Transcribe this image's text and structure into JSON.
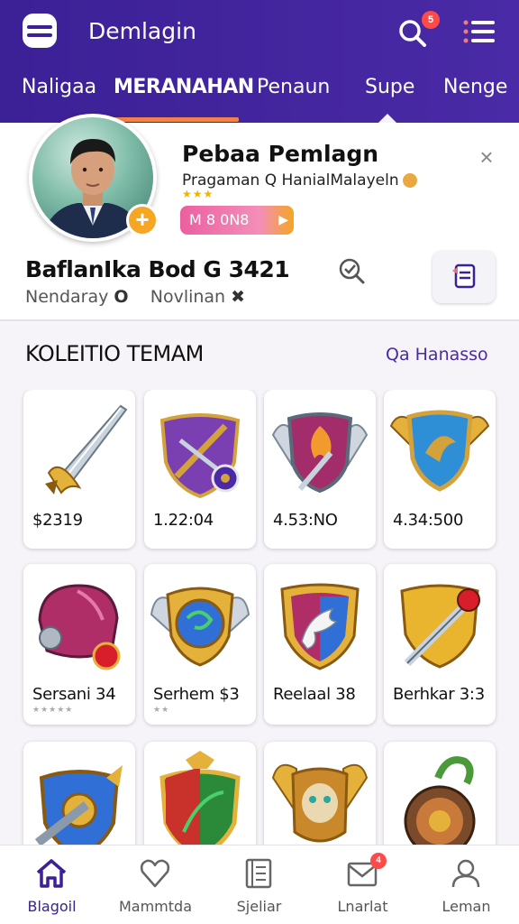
{
  "header": {
    "title": "Demlagin",
    "notification_count": "5",
    "colors": {
      "background": "#3b2096",
      "accent": "#f2824a"
    }
  },
  "tabs": [
    {
      "label": "Naligaa",
      "active": false
    },
    {
      "label": "MERANAHAN",
      "active": true
    },
    {
      "label": "Penaun",
      "active": false
    },
    {
      "label": "Supe",
      "active": false
    },
    {
      "label": "Nenge",
      "active": false
    }
  ],
  "profile": {
    "name": "Pebaa Pemlagn",
    "subtitle": "Pragaman  Q  HanialMalayeln",
    "stars": "★★★",
    "pill_label": "M 8 0N8",
    "main_title": "BaflanIka Bod G 3421",
    "meta_left": "Nendaray",
    "meta_left_icon": "O",
    "meta_right": "Novlinan",
    "meta_right_icon": "✖"
  },
  "section": {
    "title": "KOLEITIO TEMAM",
    "link": "Qa Hanasso"
  },
  "items": [
    {
      "label": "$2319",
      "sublabel": "",
      "icon": "sword-icon"
    },
    {
      "label": "1.22:04",
      "sublabel": "",
      "icon": "shield-sword-icon"
    },
    {
      "label": "4.53:NO",
      "sublabel": "",
      "icon": "winged-shield-torch-icon"
    },
    {
      "label": "4.34:500",
      "sublabel": "",
      "icon": "winged-shield-bird-icon"
    },
    {
      "label": "Sersani 34",
      "sublabel": "★★★★★",
      "icon": "helmet-icon"
    },
    {
      "label": "Serhem $3",
      "sublabel": "★★",
      "icon": "winged-orb-shield-icon"
    },
    {
      "label": "Reelaal 38",
      "sublabel": "",
      "icon": "shield-pegasus-icon"
    },
    {
      "label": "Berhkar 3:3",
      "sublabel": "",
      "icon": "shield-dagger-icon"
    },
    {
      "label": "",
      "sublabel": "",
      "icon": "shield-cannon-icon"
    },
    {
      "label": "",
      "sublabel": "",
      "icon": "shield-leaf-icon"
    },
    {
      "label": "",
      "sublabel": "",
      "icon": "winged-skull-icon"
    },
    {
      "label": "",
      "sublabel": "",
      "icon": "potion-barrel-icon"
    }
  ],
  "bottom_nav": [
    {
      "label": "Blagoil",
      "icon": "home-icon",
      "active": true
    },
    {
      "label": "Mammtda",
      "icon": "heart-icon",
      "active": false
    },
    {
      "label": "Sjeliar",
      "icon": "document-icon",
      "active": false
    },
    {
      "label": "Lnarlat",
      "icon": "mail-icon",
      "active": false,
      "badge": "4"
    },
    {
      "label": "Leman",
      "icon": "user-icon",
      "active": false
    }
  ]
}
